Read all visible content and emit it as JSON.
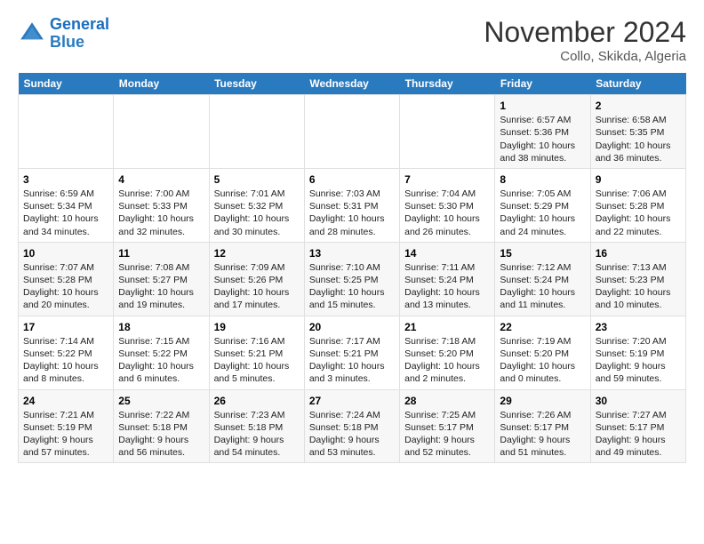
{
  "logo": {
    "line1": "General",
    "line2": "Blue"
  },
  "header": {
    "title": "November 2024",
    "location": "Collo, Skikda, Algeria"
  },
  "days_of_week": [
    "Sunday",
    "Monday",
    "Tuesday",
    "Wednesday",
    "Thursday",
    "Friday",
    "Saturday"
  ],
  "weeks": [
    [
      {
        "day": "",
        "info": ""
      },
      {
        "day": "",
        "info": ""
      },
      {
        "day": "",
        "info": ""
      },
      {
        "day": "",
        "info": ""
      },
      {
        "day": "",
        "info": ""
      },
      {
        "day": "1",
        "info": "Sunrise: 6:57 AM\nSunset: 5:36 PM\nDaylight: 10 hours and 38 minutes."
      },
      {
        "day": "2",
        "info": "Sunrise: 6:58 AM\nSunset: 5:35 PM\nDaylight: 10 hours and 36 minutes."
      }
    ],
    [
      {
        "day": "3",
        "info": "Sunrise: 6:59 AM\nSunset: 5:34 PM\nDaylight: 10 hours and 34 minutes."
      },
      {
        "day": "4",
        "info": "Sunrise: 7:00 AM\nSunset: 5:33 PM\nDaylight: 10 hours and 32 minutes."
      },
      {
        "day": "5",
        "info": "Sunrise: 7:01 AM\nSunset: 5:32 PM\nDaylight: 10 hours and 30 minutes."
      },
      {
        "day": "6",
        "info": "Sunrise: 7:03 AM\nSunset: 5:31 PM\nDaylight: 10 hours and 28 minutes."
      },
      {
        "day": "7",
        "info": "Sunrise: 7:04 AM\nSunset: 5:30 PM\nDaylight: 10 hours and 26 minutes."
      },
      {
        "day": "8",
        "info": "Sunrise: 7:05 AM\nSunset: 5:29 PM\nDaylight: 10 hours and 24 minutes."
      },
      {
        "day": "9",
        "info": "Sunrise: 7:06 AM\nSunset: 5:28 PM\nDaylight: 10 hours and 22 minutes."
      }
    ],
    [
      {
        "day": "10",
        "info": "Sunrise: 7:07 AM\nSunset: 5:28 PM\nDaylight: 10 hours and 20 minutes."
      },
      {
        "day": "11",
        "info": "Sunrise: 7:08 AM\nSunset: 5:27 PM\nDaylight: 10 hours and 19 minutes."
      },
      {
        "day": "12",
        "info": "Sunrise: 7:09 AM\nSunset: 5:26 PM\nDaylight: 10 hours and 17 minutes."
      },
      {
        "day": "13",
        "info": "Sunrise: 7:10 AM\nSunset: 5:25 PM\nDaylight: 10 hours and 15 minutes."
      },
      {
        "day": "14",
        "info": "Sunrise: 7:11 AM\nSunset: 5:24 PM\nDaylight: 10 hours and 13 minutes."
      },
      {
        "day": "15",
        "info": "Sunrise: 7:12 AM\nSunset: 5:24 PM\nDaylight: 10 hours and 11 minutes."
      },
      {
        "day": "16",
        "info": "Sunrise: 7:13 AM\nSunset: 5:23 PM\nDaylight: 10 hours and 10 minutes."
      }
    ],
    [
      {
        "day": "17",
        "info": "Sunrise: 7:14 AM\nSunset: 5:22 PM\nDaylight: 10 hours and 8 minutes."
      },
      {
        "day": "18",
        "info": "Sunrise: 7:15 AM\nSunset: 5:22 PM\nDaylight: 10 hours and 6 minutes."
      },
      {
        "day": "19",
        "info": "Sunrise: 7:16 AM\nSunset: 5:21 PM\nDaylight: 10 hours and 5 minutes."
      },
      {
        "day": "20",
        "info": "Sunrise: 7:17 AM\nSunset: 5:21 PM\nDaylight: 10 hours and 3 minutes."
      },
      {
        "day": "21",
        "info": "Sunrise: 7:18 AM\nSunset: 5:20 PM\nDaylight: 10 hours and 2 minutes."
      },
      {
        "day": "22",
        "info": "Sunrise: 7:19 AM\nSunset: 5:20 PM\nDaylight: 10 hours and 0 minutes."
      },
      {
        "day": "23",
        "info": "Sunrise: 7:20 AM\nSunset: 5:19 PM\nDaylight: 9 hours and 59 minutes."
      }
    ],
    [
      {
        "day": "24",
        "info": "Sunrise: 7:21 AM\nSunset: 5:19 PM\nDaylight: 9 hours and 57 minutes."
      },
      {
        "day": "25",
        "info": "Sunrise: 7:22 AM\nSunset: 5:18 PM\nDaylight: 9 hours and 56 minutes."
      },
      {
        "day": "26",
        "info": "Sunrise: 7:23 AM\nSunset: 5:18 PM\nDaylight: 9 hours and 54 minutes."
      },
      {
        "day": "27",
        "info": "Sunrise: 7:24 AM\nSunset: 5:18 PM\nDaylight: 9 hours and 53 minutes."
      },
      {
        "day": "28",
        "info": "Sunrise: 7:25 AM\nSunset: 5:17 PM\nDaylight: 9 hours and 52 minutes."
      },
      {
        "day": "29",
        "info": "Sunrise: 7:26 AM\nSunset: 5:17 PM\nDaylight: 9 hours and 51 minutes."
      },
      {
        "day": "30",
        "info": "Sunrise: 7:27 AM\nSunset: 5:17 PM\nDaylight: 9 hours and 49 minutes."
      }
    ]
  ]
}
